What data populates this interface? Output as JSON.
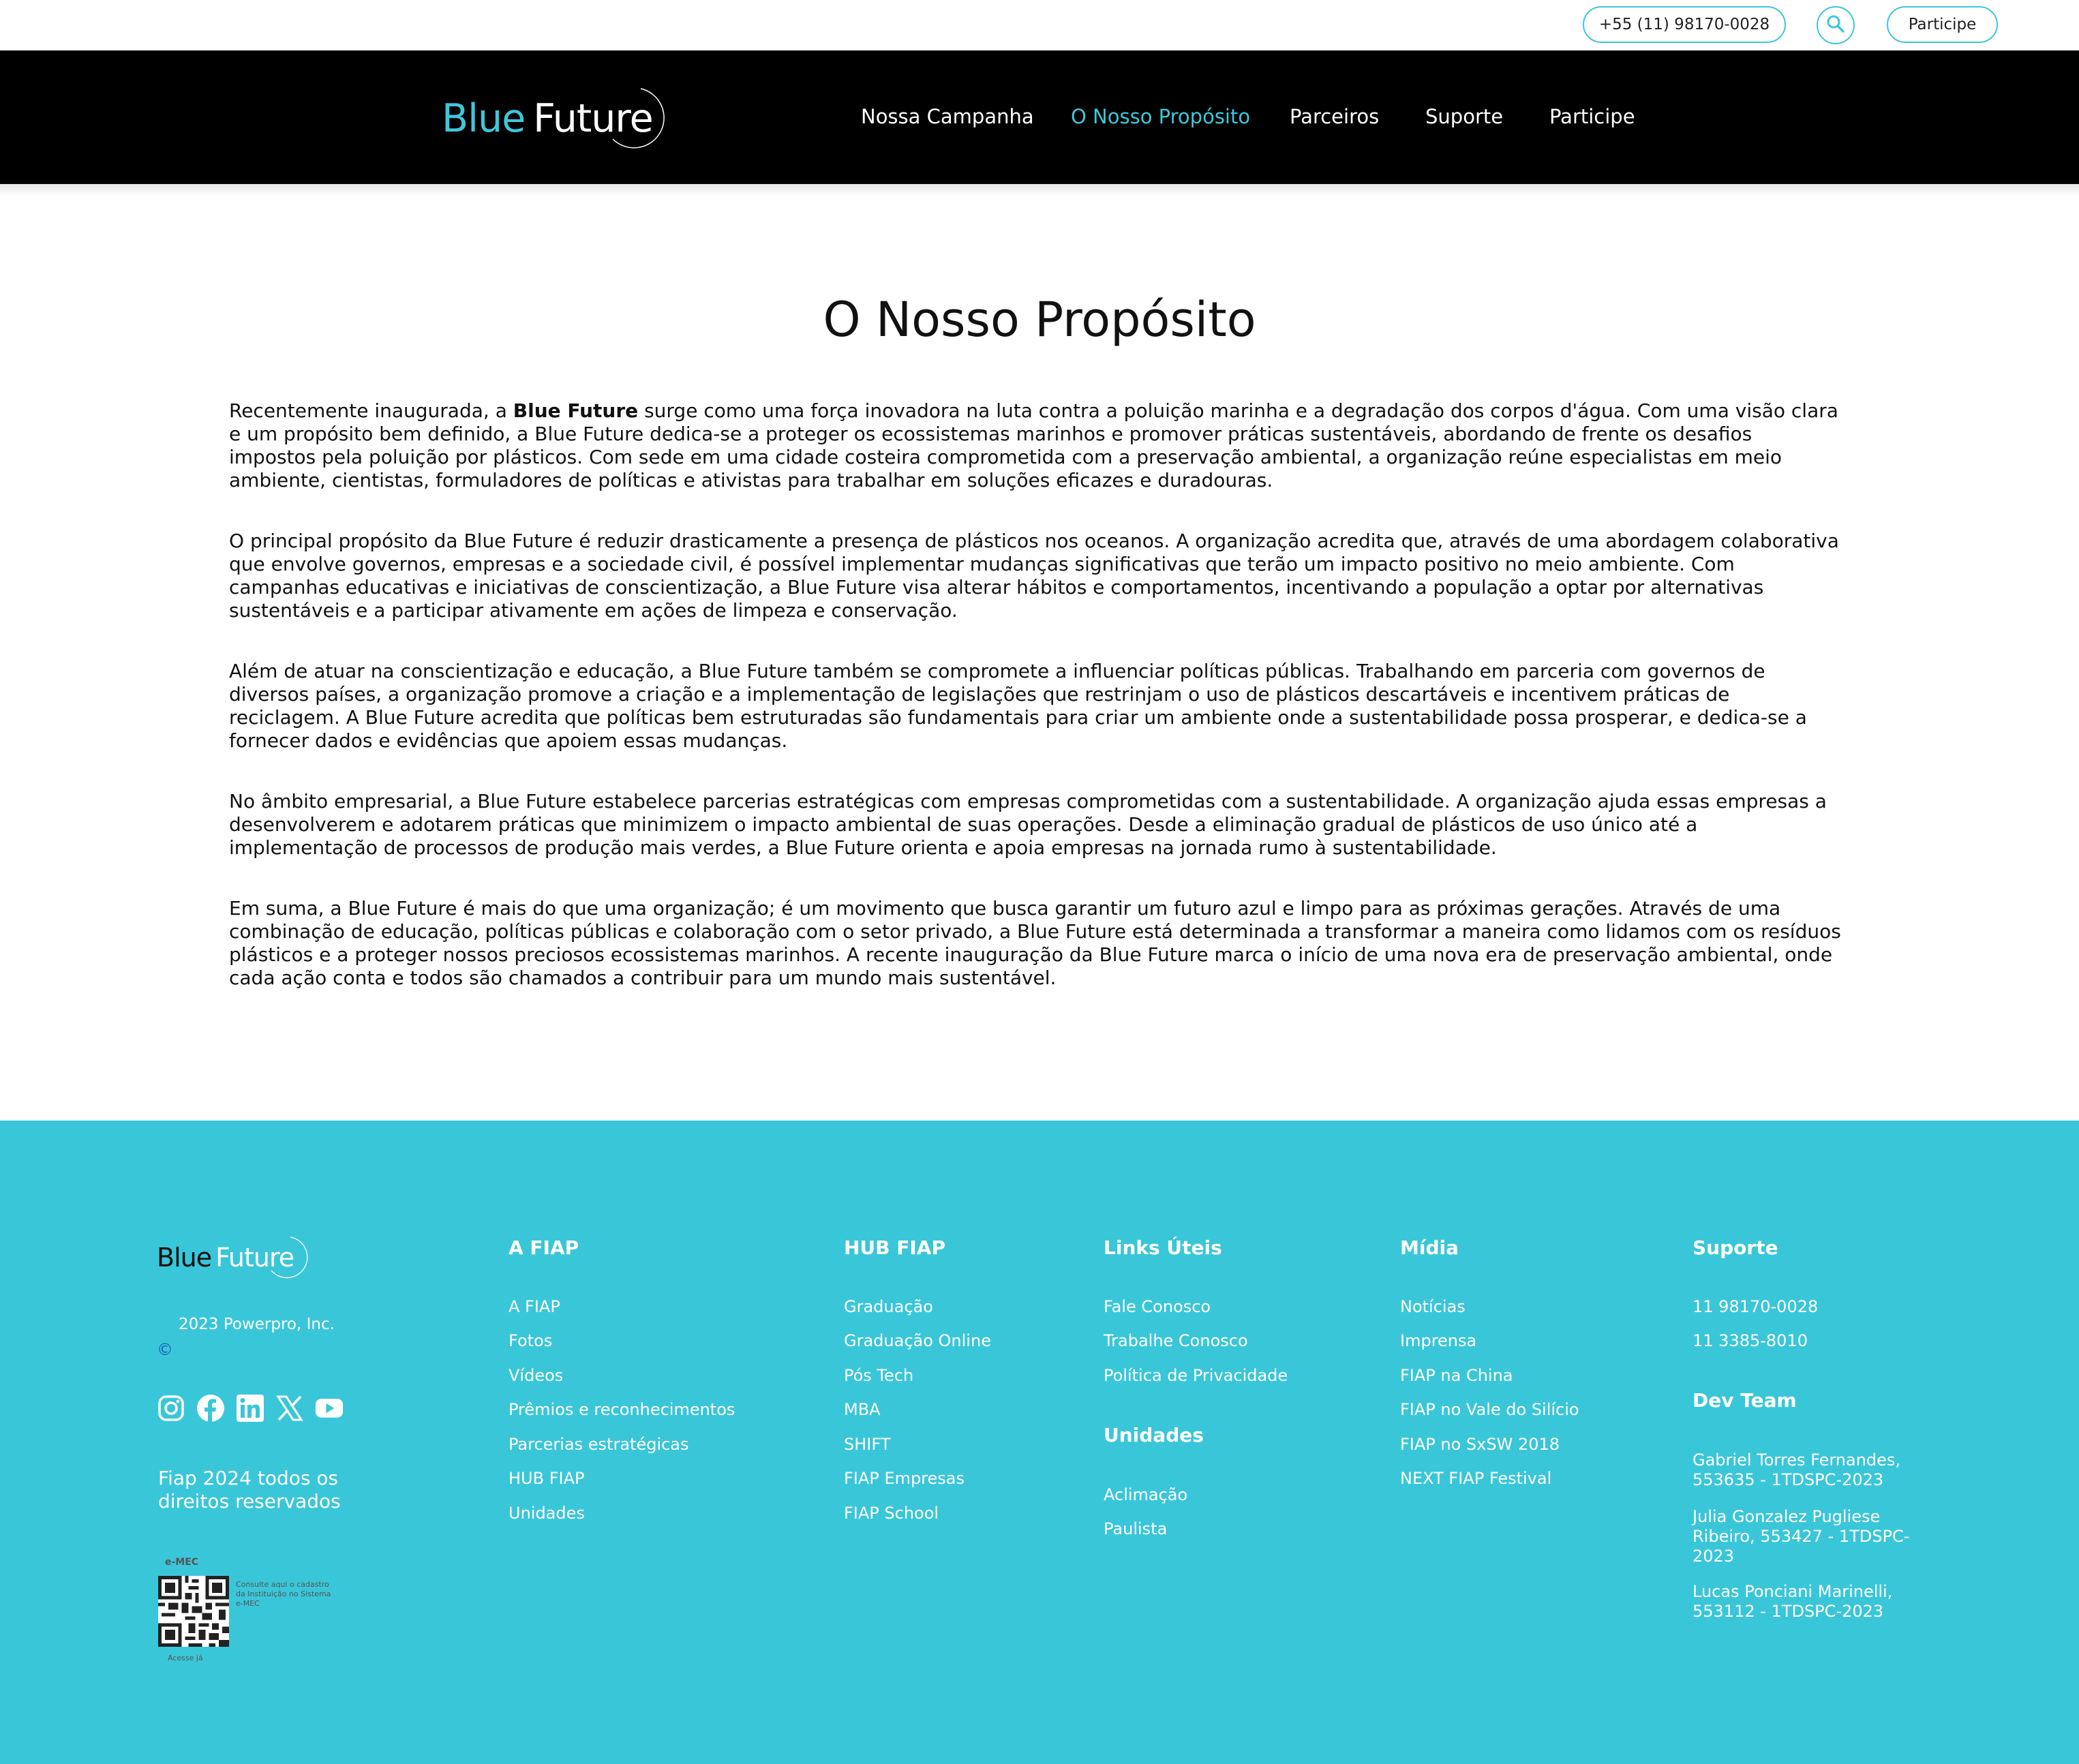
{
  "topbar": {
    "phone": "+55 (11) 98170-0028",
    "participe": "Participe"
  },
  "brand": {
    "part1": "Blue",
    "part2": "Future"
  },
  "nav": {
    "items": [
      {
        "label": "Nossa Campanha",
        "active": false
      },
      {
        "label": "O Nosso Propósito",
        "active": true
      },
      {
        "label": "Parceiros",
        "active": false
      },
      {
        "label": "Suporte",
        "active": false
      },
      {
        "label": "Participe",
        "active": false
      }
    ]
  },
  "main": {
    "title": "O Nosso Propósito",
    "paragraph1_pre": "Recentemente inaugurada, a ",
    "paragraph1_bold": "Blue Future",
    "paragraph1_post": " surge como uma força inovadora na luta contra a poluição marinha e a degradação dos corpos d'água. Com uma visão clara e um propósito bem definido, a Blue Future dedica-se a proteger os ecossistemas marinhos e promover práticas sustentáveis, abordando de frente os desafios impostos pela poluição por plásticos. Com sede em uma cidade costeira comprometida com a preservação ambiental, a organização reúne especialistas em meio ambiente, cientistas, formuladores de políticas e ativistas para trabalhar em soluções eficazes e duradouras.",
    "paragraph2": "O principal propósito da Blue Future é reduzir drasticamente a presença de plásticos nos oceanos. A organização acredita que, através de uma abordagem colaborativa que envolve governos, empresas e a sociedade civil, é possível implementar mudanças significativas que terão um impacto positivo no meio ambiente. Com campanhas educativas e iniciativas de conscientização, a Blue Future visa alterar hábitos e comportamentos, incentivando a população a optar por alternativas sustentáveis e a participar ativamente em ações de limpeza e conservação.",
    "paragraph3": "Além de atuar na conscientização e educação, a Blue Future também se compromete a influenciar políticas públicas. Trabalhando em parceria com governos de diversos países, a organização promove a criação e a implementação de legislações que restrinjam o uso de plásticos descartáveis e incentivem práticas de reciclagem. A Blue Future acredita que políticas bem estruturadas são fundamentais para criar um ambiente onde a sustentabilidade possa prosperar, e dedica-se a fornecer dados e evidências que apoiem essas mudanças.",
    "paragraph4": "No âmbito empresarial, a Blue Future estabelece parcerias estratégicas com empresas comprometidas com a sustentabilidade. A organização ajuda essas empresas a desenvolverem e adotarem práticas que minimizem o impacto ambiental de suas operações. Desde a eliminação gradual de plásticos de uso único até a implementação de processos de produção mais verdes, a Blue Future orienta e apoia empresas na jornada rumo à sustentabilidade.",
    "paragraph5": "Em suma, a Blue Future é mais do que uma organização; é um movimento que busca garantir um futuro azul e limpo para as próximas gerações. Através de uma combinação de educação, políticas públicas e colaboração com o setor privado, a Blue Future está determinada a transformar a maneira como lidamos com os resíduos plásticos e a proteger nossos preciosos ecossistemas marinhos. A recente inauguração da Blue Future marca o início de uma nova era de preservação ambiental, onde cada ação conta e todos são chamados a contribuir para um mundo mais sustentável."
  },
  "footer": {
    "copyright": "2023 Powerpro, Inc.",
    "copyright_symbol": "©",
    "rights": "Fiap 2024 todos os direitos reservados",
    "emec": {
      "label": "e-MEC",
      "note": "Consulte aqui o cadastro da Instituição no Sistema e-MEC",
      "access": "Acesse já"
    },
    "col_fiap": {
      "title": "A FIAP",
      "links": [
        "A FIAP",
        "Fotos",
        "Vídeos",
        "Prêmios e reconhecimentos",
        "Parcerias estratégicas",
        "HUB FIAP",
        "Unidades"
      ]
    },
    "col_hub": {
      "title": "HUB FIAP",
      "links": [
        "Graduação",
        "Graduação Online",
        "Pós Tech",
        "MBA",
        "SHIFT",
        "FIAP Empresas",
        "FIAP School"
      ]
    },
    "col_links": {
      "title": "Links Úteis",
      "links": [
        "Fale Conosco",
        "Trabalhe Conosco",
        "Política de Privacidade"
      ]
    },
    "col_unidades": {
      "title": "Unidades",
      "links": [
        "Aclimação",
        "Paulista"
      ]
    },
    "col_midia": {
      "title": "Mídia",
      "links": [
        "Notícias",
        "Imprensa",
        "FIAP na China",
        "FIAP no Vale do Silício",
        "FIAP no SxSW 2018",
        "NEXT FIAP Festival"
      ]
    },
    "col_suporte": {
      "title": "Suporte",
      "links": [
        "11 98170-0028",
        "11 3385-8010"
      ]
    },
    "col_dev": {
      "title": "Dev Team",
      "members": [
        "Gabriel Torres Fernandes, 553635 - 1TDSPC-2023",
        "Julia Gonzalez Pugliese Ribeiro, 553427 - 1TDSPC-2023",
        "Lucas Ponciani Marinelli, 553112 - 1TDSPC-2023"
      ]
    },
    "social_icons": [
      "instagram-icon",
      "facebook-icon",
      "linkedin-icon",
      "x-icon",
      "youtube-icon"
    ]
  },
  "colors": {
    "accent": "#3ec7da",
    "footer_bg": "#3ac6d9",
    "nav_bg": "#000000"
  }
}
